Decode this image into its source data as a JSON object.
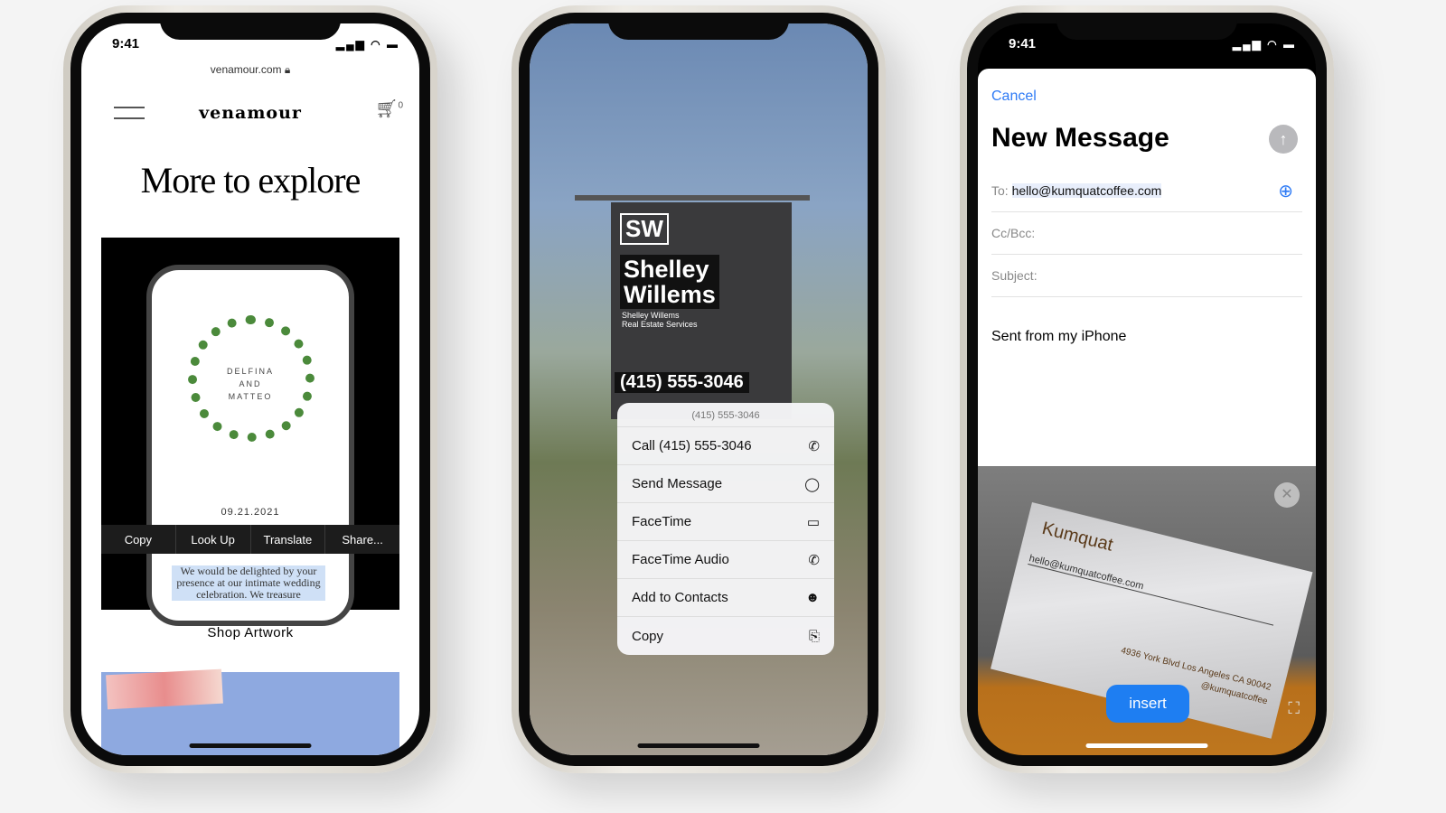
{
  "status": {
    "time": "9:41"
  },
  "phone1": {
    "url": "venamour.com",
    "logo": "venamour",
    "cart_count": "0",
    "heading": "More to explore",
    "invite_names": [
      "DELFINA",
      "AND",
      "MATTEO"
    ],
    "invite_date": "09.21.2021",
    "edit_menu": [
      "Copy",
      "Look Up",
      "Translate",
      "Share..."
    ],
    "selected_text": "We would be delighted by your presence at our intimate wedding celebration. We treasure",
    "shop_link": "Shop Artwork"
  },
  "phone2": {
    "sign": {
      "initials": "SW",
      "name_line1": "Shelley",
      "name_line2": "Willems",
      "sub1": "Shelley Willems",
      "sub2": "Real Estate Services",
      "phone": "(415) 555-3046"
    },
    "menu": {
      "header": "(415) 555-3046",
      "items": [
        {
          "label": "Call (415) 555-3046",
          "icon": "phone-icon",
          "glyph": "✆"
        },
        {
          "label": "Send Message",
          "icon": "message-bubble-icon",
          "glyph": "💬"
        },
        {
          "label": "FaceTime",
          "icon": "video-camera-icon",
          "glyph": "▭"
        },
        {
          "label": "FaceTime Audio",
          "icon": "phone-icon",
          "glyph": "✆"
        },
        {
          "label": "Add to Contacts",
          "icon": "add-contact-icon",
          "glyph": "☻"
        },
        {
          "label": "Copy",
          "icon": "copy-icon",
          "glyph": "⎘"
        }
      ]
    }
  },
  "phone3": {
    "cancel": "Cancel",
    "title": "New Message",
    "to_label": "To:",
    "to_value": "hello@kumquatcoffee.com",
    "cc_label": "Cc/Bcc:",
    "subject_label": "Subject:",
    "body": "Sent from my iPhone",
    "card": {
      "brand": "Kumquat",
      "email": "hello@kumquatcoffee.com",
      "address": "4936 York Blvd Los Angeles CA 90042",
      "handle": "@kumquatcoffee"
    },
    "insert_label": "insert"
  },
  "colors": {
    "accent": "#2f7bf5",
    "insert_button": "#1e7ef2"
  }
}
